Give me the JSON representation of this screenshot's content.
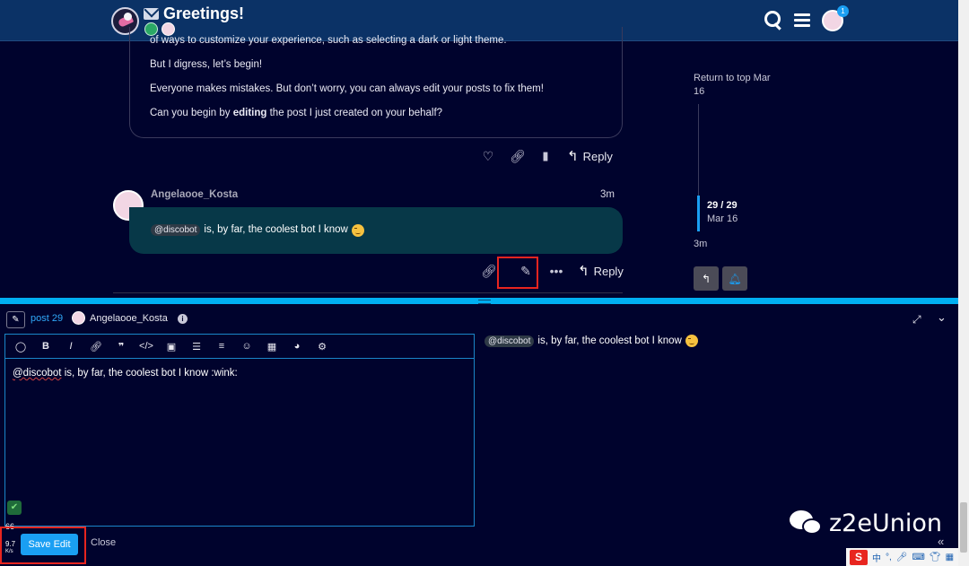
{
  "header": {
    "title": "Greetings!",
    "notification_count": "1"
  },
  "posts": [
    {
      "paragraphs": [
        "of ways to customize your experience, such as selecting a dark or light theme.",
        "But I digress, let’s begin!",
        "Everyone makes mistakes. But don’t worry, you can always edit your posts to fix them!"
      ],
      "last_para_prefix": "Can you begin by ",
      "last_para_bold": "editing",
      "last_para_suffix": " the post I just created on your behalf?",
      "reply_label": "Reply"
    },
    {
      "username": "Angelaooe_Kosta",
      "time": "3m",
      "mention": "@discobot",
      "body": "is, by far, the coolest bot I know",
      "reply_label": "Reply"
    }
  ],
  "timeline": {
    "return_to_top": "Return to top Mar 16",
    "count": "29 / 29",
    "date": "Mar 16",
    "latest": "3m"
  },
  "composer": {
    "post_ref": "post 29",
    "username": "Angelaooe_Kosta",
    "editor_mention": "@discobot",
    "editor_text": " is, by far, the coolest bot I know :wink:",
    "preview_mention": "@discobot",
    "preview_text": "is, by far, the coolest bot I know",
    "save_label": "Save Edit",
    "close_label": "Close"
  },
  "overlay": {
    "meter_top": "66",
    "meter_value": "9.7",
    "meter_unit": "K/s",
    "watermark": "z2eUnion",
    "tray_sogou": "S",
    "tray_lang": "中"
  }
}
